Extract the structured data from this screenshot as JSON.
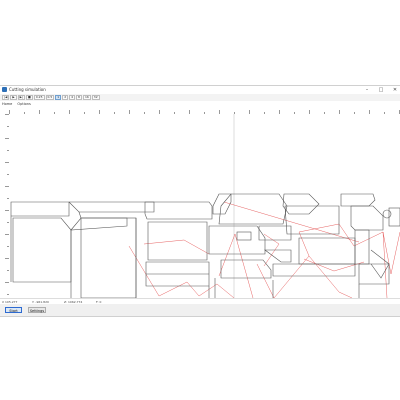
{
  "window": {
    "title": "Cutting simulation"
  },
  "toolbar": {
    "buttons": [
      "|◀",
      "▶",
      "▶|",
      "■",
      "0.25",
      "0.5",
      "1",
      "2",
      "4",
      "8",
      "16",
      "32"
    ],
    "active_index": 6
  },
  "menu": {
    "items": [
      "Home",
      "Options"
    ]
  },
  "status": {
    "fields": [
      "X 105.277",
      "Y: -961.820",
      "Z: 1062.774",
      "F: 0"
    ]
  },
  "buttons": {
    "start": "Start",
    "settings": "Settings"
  },
  "colors": {
    "accent": "#2d6ad1",
    "toolpath": "#e03a3a",
    "outline": "#555555"
  }
}
